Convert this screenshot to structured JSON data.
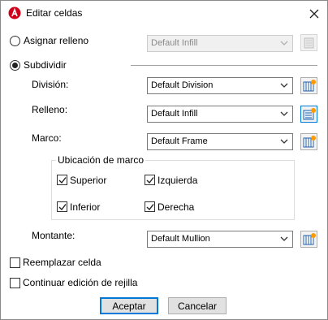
{
  "dialog": {
    "title": "Editar celdas",
    "app_icon": "autocad-a-icon",
    "accent_color": "#d0021b"
  },
  "options": {
    "assign_fill": {
      "label": "Asignar relleno",
      "selected": false,
      "value": "Default Infill",
      "enabled": false
    },
    "subdivide": {
      "label": "Subdividir",
      "selected": true
    }
  },
  "fields": {
    "division": {
      "label": "División:",
      "value": "Default Division"
    },
    "infill": {
      "label": "Relleno:",
      "value": "Default Infill"
    },
    "frame": {
      "label": "Marco:",
      "value": "Default Frame"
    },
    "mullion": {
      "label": "Montante:",
      "value": "Default Mullion"
    }
  },
  "frame_location": {
    "legend": "Ubicación de marco",
    "top": {
      "label": "Superior",
      "checked": true
    },
    "left": {
      "label": "Izquierda",
      "checked": true
    },
    "bottom": {
      "label": "Inferior",
      "checked": true
    },
    "right": {
      "label": "Derecha",
      "checked": true
    }
  },
  "replace_cell": {
    "label": "Reemplazar celda",
    "checked": false
  },
  "continue_editing": {
    "label": "Continuar edición de rejilla",
    "checked": false
  },
  "buttons": {
    "ok": "Aceptar",
    "cancel": "Cancelar"
  }
}
